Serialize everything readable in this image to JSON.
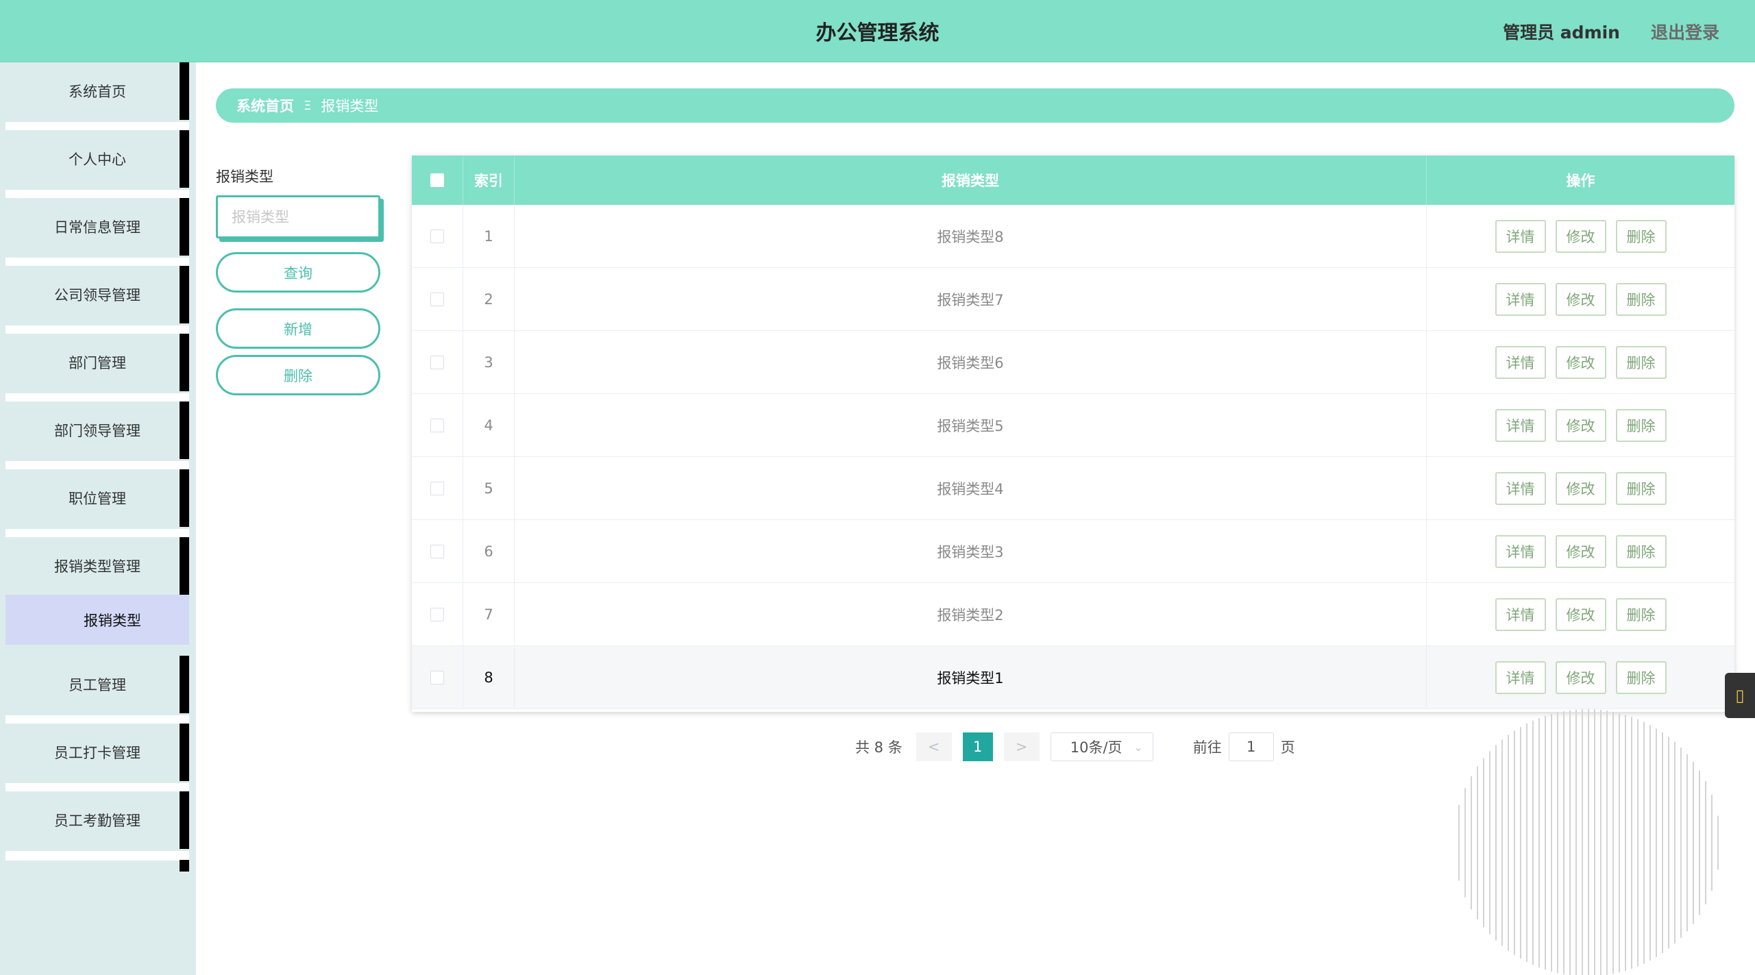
{
  "header": {
    "title": "办公管理系统",
    "admin_label": "管理员 admin",
    "logout_label": "退出登录"
  },
  "sidebar": {
    "items": [
      {
        "label": "系统首页"
      },
      {
        "label": "个人中心"
      },
      {
        "label": "日常信息管理"
      },
      {
        "label": "公司领导管理"
      },
      {
        "label": "部门管理"
      },
      {
        "label": "部门领导管理"
      },
      {
        "label": "职位管理"
      },
      {
        "label": "报销类型管理"
      },
      {
        "label": "员工管理"
      },
      {
        "label": "员工打卡管理"
      },
      {
        "label": "员工考勤管理"
      }
    ],
    "sub_active": "报销类型"
  },
  "breadcrumb": {
    "home": "系统首页",
    "separator": "Ξ",
    "current": "报销类型"
  },
  "filter": {
    "label": "报销类型",
    "placeholder": "报销类型",
    "query_label": "查询",
    "add_label": "新增",
    "delete_label": "删除"
  },
  "table": {
    "headers": {
      "index": "索引",
      "type": "报销类型",
      "actions": "操作"
    },
    "rows": [
      {
        "index": "1",
        "type": "报销类型8"
      },
      {
        "index": "2",
        "type": "报销类型7"
      },
      {
        "index": "3",
        "type": "报销类型6"
      },
      {
        "index": "4",
        "type": "报销类型5"
      },
      {
        "index": "5",
        "type": "报销类型4"
      },
      {
        "index": "6",
        "type": "报销类型3"
      },
      {
        "index": "7",
        "type": "报销类型2"
      },
      {
        "index": "8",
        "type": "报销类型1"
      }
    ],
    "actions": {
      "detail": "详情",
      "edit": "修改",
      "delete": "删除"
    }
  },
  "pagination": {
    "total_text": "共 8 条",
    "prev": "<",
    "next": ">",
    "current_page": "1",
    "page_size": "10条/页",
    "goto_label": "前往",
    "goto_value": "1",
    "page_suffix": "页"
  },
  "colors": {
    "accent": "#80e0c8",
    "teal_dark": "#4bbfae",
    "page_active": "#20a8a0",
    "sub_active_bg": "#d2d8f5"
  }
}
